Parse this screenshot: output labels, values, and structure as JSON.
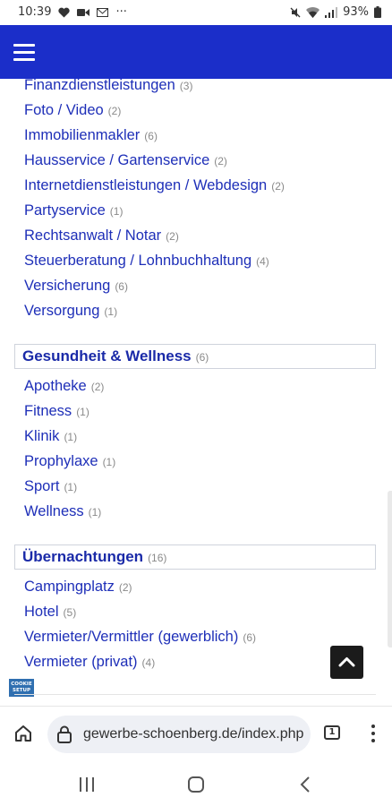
{
  "status_bar": {
    "time": "10:39",
    "ellipsis": "···",
    "battery": "93%",
    "icons": [
      "heart-icon",
      "video-icon",
      "envelope-icon",
      "mute-icon",
      "wifi-icon",
      "signal-icon",
      "battery-icon"
    ]
  },
  "header": {
    "menu_icon": "hamburger-icon",
    "color": "#1b2ec9"
  },
  "lists": {
    "services": [
      {
        "label": "Finanzdienstleistungen",
        "count": "(3)"
      },
      {
        "label": "Foto / Video",
        "count": "(2)"
      },
      {
        "label": "Immobilienmakler",
        "count": "(6)"
      },
      {
        "label": "Hausservice / Gartenservice",
        "count": "(2)"
      },
      {
        "label": "Internetdienstleistungen / Webdesign",
        "count": "(2)"
      },
      {
        "label": "Partyservice",
        "count": "(1)"
      },
      {
        "label": "Rechtsanwalt / Notar",
        "count": "(2)"
      },
      {
        "label": "Steuerberatung / Lohnbuchhaltung",
        "count": "(4)"
      },
      {
        "label": "Versicherung",
        "count": "(6)"
      },
      {
        "label": "Versorgung",
        "count": "(1)"
      }
    ],
    "health_section": {
      "title": "Gesundheit & Wellness",
      "count": "(6)"
    },
    "health": [
      {
        "label": "Apotheke",
        "count": "(2)"
      },
      {
        "label": "Fitness",
        "count": "(1)"
      },
      {
        "label": "Klinik",
        "count": "(1)"
      },
      {
        "label": "Prophylaxe",
        "count": "(1)"
      },
      {
        "label": "Sport",
        "count": "(1)"
      },
      {
        "label": "Wellness",
        "count": "(1)"
      }
    ],
    "stay_section": {
      "title": "Übernachtungen",
      "count": "(16)"
    },
    "stays": [
      {
        "label": "Campingplatz",
        "count": "(2)"
      },
      {
        "label": "Hotel",
        "count": "(5)"
      },
      {
        "label": "Vermieter/Vermittler (gewerblich)",
        "count": "(6)"
      },
      {
        "label": "Vermieter (privat)",
        "count": "(4)"
      }
    ]
  },
  "cookie_setup": {
    "line1": "COOKIE",
    "line2": "SETUP"
  },
  "browser": {
    "url": "gewerbe-schoenberg.de/index.php",
    "tab_count": "1"
  },
  "colors": {
    "link": "#1e2fb8",
    "count": "#8a8a8a",
    "header": "#1b2ec9"
  }
}
